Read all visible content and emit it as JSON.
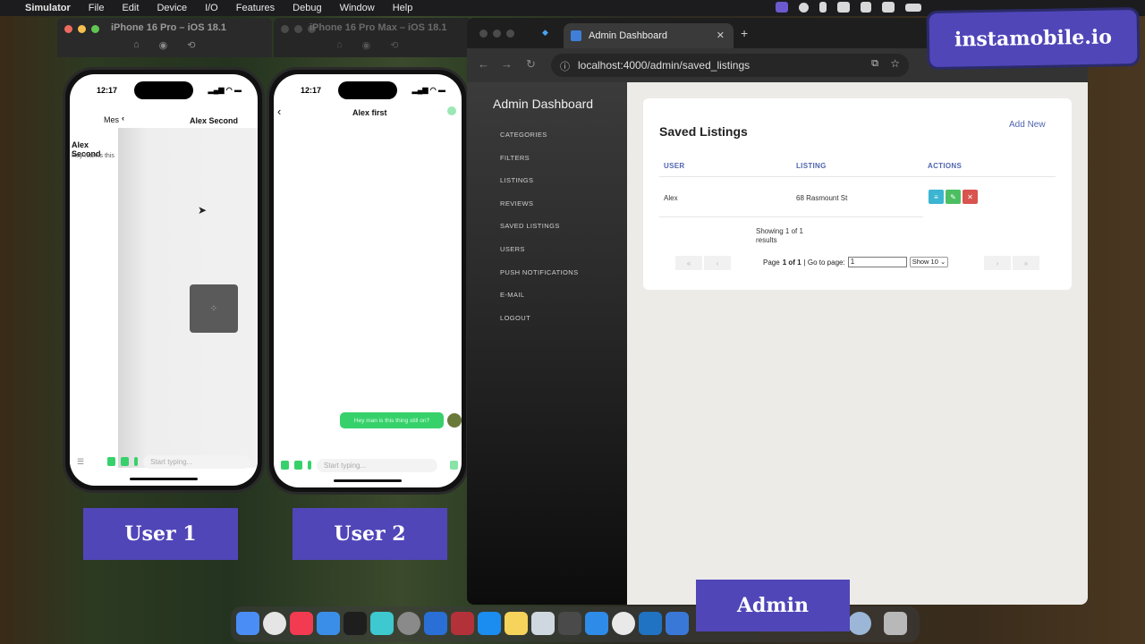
{
  "menubar": {
    "app": "Simulator",
    "items": [
      "File",
      "Edit",
      "Device",
      "I/O",
      "Features",
      "Debug",
      "Window",
      "Help"
    ]
  },
  "simulators": [
    {
      "title": "iPhone 16 Pro – iOS 18.1"
    },
    {
      "title": "iPhone 16 Pro Max – iOS 18.1"
    }
  ],
  "phone1": {
    "time": "12:17",
    "back_label": "Mes",
    "title": "Alex Second",
    "list_name": "Alex Second",
    "list_preview": "Hey man is this",
    "placeholder": "Start typing..."
  },
  "phone2": {
    "time": "12:17",
    "title": "Alex first",
    "bubble": "Hey man is this thing still on?",
    "placeholder": "Start typing..."
  },
  "labels": {
    "user1": "User 1",
    "user2": "User 2",
    "admin": "Admin"
  },
  "brand": "instamobile.io",
  "browser": {
    "tab_title": "Admin Dashboard",
    "url": "localhost:4000/admin/saved_listings"
  },
  "sidebar": {
    "title": "Admin Dashboard",
    "items": [
      "CATEGORIES",
      "FILTERS",
      "LISTINGS",
      "REVIEWS",
      "SAVED LISTINGS",
      "USERS",
      "PUSH NOTIFICATIONS",
      "E-MAIL",
      "LOGOUT"
    ]
  },
  "main": {
    "heading": "Saved Listings",
    "add_new": "Add New",
    "columns": [
      "USER",
      "LISTING",
      "ACTIONS"
    ],
    "rows": [
      {
        "user": "Alex",
        "listing": "68 Rasmount St"
      }
    ],
    "showing": "Showing 1 of 1 results",
    "page_prefix": "Page",
    "page_value": "1 of 1",
    "goto_label": "| Go to page:",
    "goto_value": "1",
    "show_select": "Show 10"
  },
  "colors": {
    "accent": "#5046b8",
    "green": "#37d16b",
    "info": "#3bb5d1",
    "edit": "#4cbf62",
    "delete": "#d9534f"
  }
}
